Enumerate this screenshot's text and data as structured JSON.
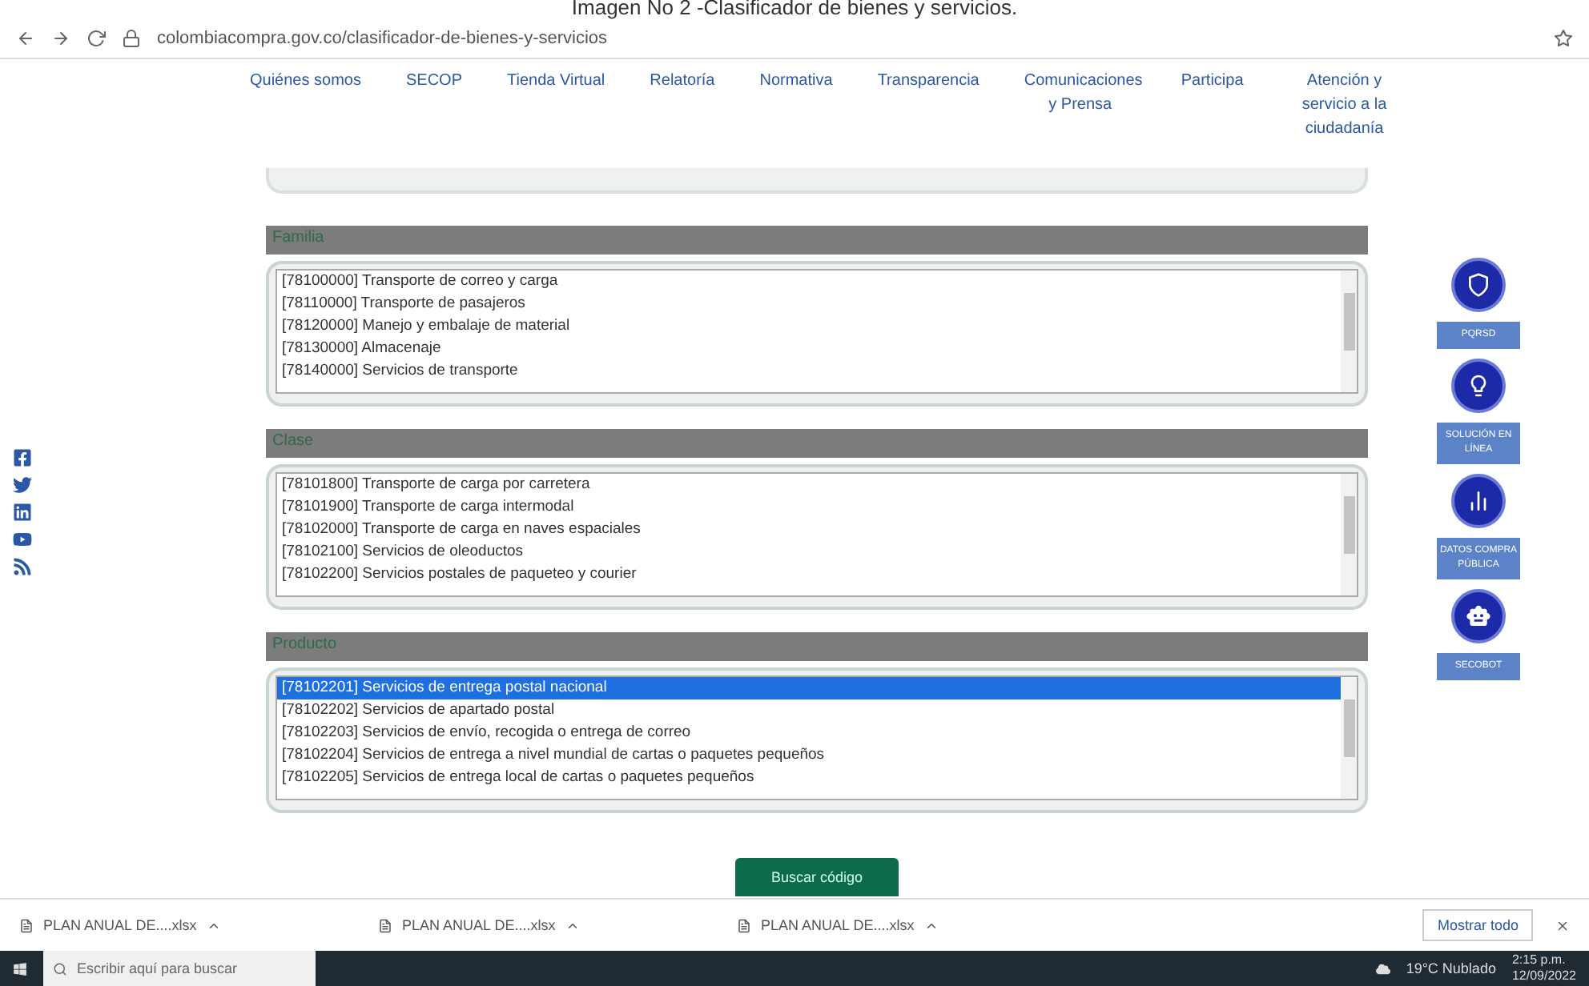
{
  "caption": "Imagen No 2 -Clasificador de bienes y servicios.",
  "browser": {
    "url": "colombiacompra.gov.co/clasificador-de-bienes-y-servicios"
  },
  "nav": [
    "Quiénes somos",
    "SECOP",
    "Tienda Virtual",
    "Relatoría",
    "Normativa",
    "Transparencia",
    "Comunicaciones y Prensa",
    "Participa",
    "Atención y servicio a la ciudadanía"
  ],
  "sections": [
    {
      "title": "Familia",
      "items": [
        {
          "text": "[78100000] Transporte de correo y carga",
          "selected": false
        },
        {
          "text": "[78110000] Transporte de pasajeros",
          "selected": false
        },
        {
          "text": "[78120000] Manejo y embalaje de material",
          "selected": false
        },
        {
          "text": "[78130000] Almacenaje",
          "selected": false
        },
        {
          "text": "[78140000] Servicios de transporte",
          "selected": false
        }
      ]
    },
    {
      "title": "Clase",
      "items": [
        {
          "text": "[78101800] Transporte de carga por carretera",
          "selected": false
        },
        {
          "text": "[78101900] Transporte de carga intermodal",
          "selected": false
        },
        {
          "text": "[78102000] Transporte de carga en naves espaciales",
          "selected": false
        },
        {
          "text": "[78102100] Servicios de oleoductos",
          "selected": false
        },
        {
          "text": "[78102200] Servicios postales de paqueteo y courier",
          "selected": false
        }
      ]
    },
    {
      "title": "Producto",
      "items": [
        {
          "text": "[78102201] Servicios de entrega postal nacional",
          "selected": true
        },
        {
          "text": "[78102202] Servicios de apartado postal",
          "selected": false
        },
        {
          "text": "[78102203] Servicios de envío, recogida o entrega de correo",
          "selected": false
        },
        {
          "text": "[78102204] Servicios de entrega a nivel mundial de cartas o paquetes pequeños",
          "selected": false
        },
        {
          "text": "[78102205] Servicios de entrega local de cartas o paquetes pequeños",
          "selected": false
        }
      ]
    }
  ],
  "social": [
    {
      "kind": "facebook"
    },
    {
      "kind": "twitter"
    },
    {
      "kind": "linkedin"
    },
    {
      "kind": "youtube"
    },
    {
      "kind": "rss"
    }
  ],
  "side_links": [
    {
      "kind": "shield",
      "label": "PQRSD"
    },
    {
      "kind": "bulb",
      "label": "SOLUCIÓN EN LÍNEA"
    },
    {
      "kind": "chart",
      "label": "DATOS COMPRA PÚBLICA"
    },
    {
      "kind": "bot",
      "label": "SECOBOT"
    }
  ],
  "search_button": "Buscar código",
  "downloads": [
    "PLAN ANUAL DE....xlsx",
    "PLAN ANUAL DE....xlsx",
    "PLAN ANUAL DE....xlsx"
  ],
  "show_all": "Mostrar todo",
  "taskbar": {
    "search_placeholder": "Escribir aquí para buscar",
    "weather": "19°C Nublado",
    "time": "2:15 p.m.",
    "date": "12/09/2022"
  }
}
